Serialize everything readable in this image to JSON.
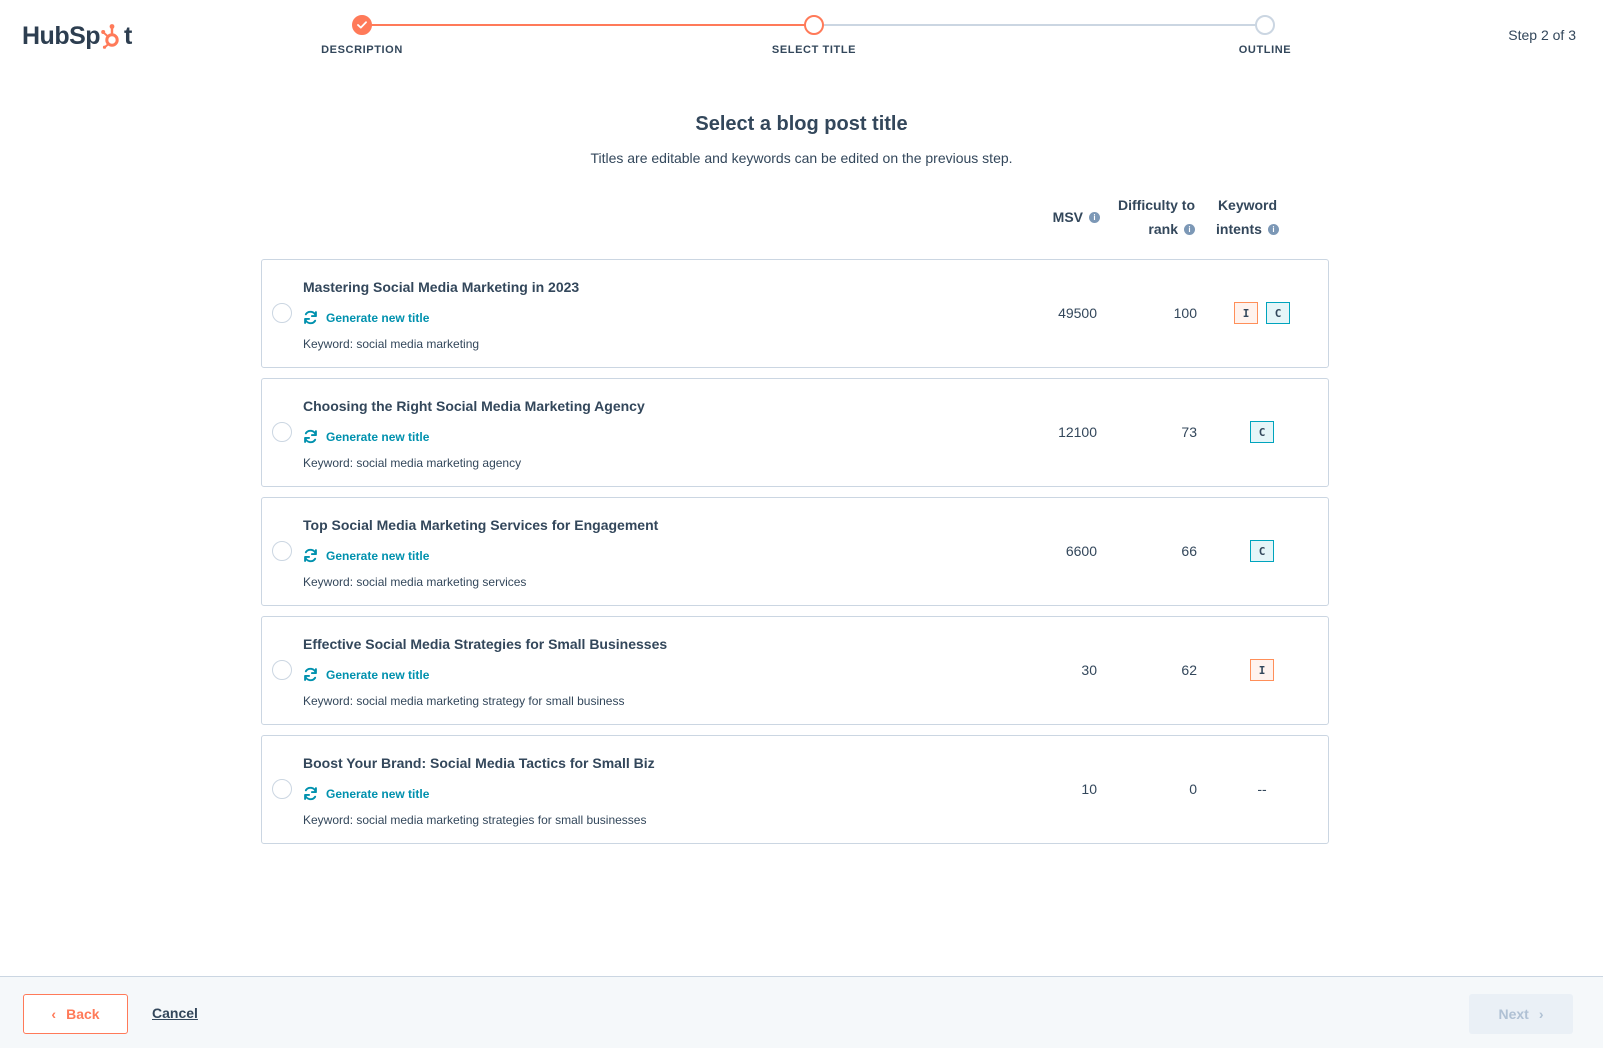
{
  "app": {
    "brand": "HubSpot",
    "step_count": "Step 2 of 3"
  },
  "stepper": {
    "steps": [
      {
        "label": "DESCRIPTION",
        "state": "complete"
      },
      {
        "label": "SELECT TITLE",
        "state": "active"
      },
      {
        "label": "OUTLINE",
        "state": "pending"
      }
    ]
  },
  "main": {
    "heading": "Select a blog post title",
    "subheading": "Titles are editable and keywords can be edited on the previous step.",
    "columns": {
      "msv": "MSV",
      "difficulty_line1": "Difficulty to",
      "difficulty_line2": "rank",
      "intents_line1": "Keyword",
      "intents_line2": "intents",
      "info_glyph": "i"
    },
    "regenerate_label": "Generate new title",
    "rows": [
      {
        "title": "Mastering Social Media Marketing in 2023",
        "keyword": "Keyword: social media marketing",
        "msv": "49500",
        "difficulty": "100",
        "intents": [
          "I",
          "C"
        ]
      },
      {
        "title": "Choosing the Right Social Media Marketing Agency",
        "keyword": "Keyword: social media marketing agency",
        "msv": "12100",
        "difficulty": "73",
        "intents": [
          "C"
        ]
      },
      {
        "title": "Top Social Media Marketing Services for Engagement",
        "keyword": "Keyword: social media marketing services",
        "msv": "6600",
        "difficulty": "66",
        "intents": [
          "C"
        ]
      },
      {
        "title": "Effective Social Media Strategies for Small Businesses",
        "keyword": "Keyword: social media marketing strategy for small business",
        "msv": "30",
        "difficulty": "62",
        "intents": [
          "I"
        ]
      },
      {
        "title": "Boost Your Brand: Social Media Tactics for Small Biz",
        "keyword": "Keyword: social media marketing strategies for small businesses",
        "msv": "10",
        "difficulty": "0",
        "intents": [],
        "intents_empty": "--"
      }
    ]
  },
  "footer": {
    "back_label": "Back",
    "cancel_label": "Cancel",
    "next_label": "Next",
    "back_chevron": "‹",
    "next_chevron": "›"
  },
  "colors": {
    "accent": "#ff7a59",
    "link": "#0091ae",
    "text": "#33475b",
    "border": "#cbd6e2",
    "intent_i_border": "#ff8f59",
    "intent_c_border": "#00a4bd"
  }
}
